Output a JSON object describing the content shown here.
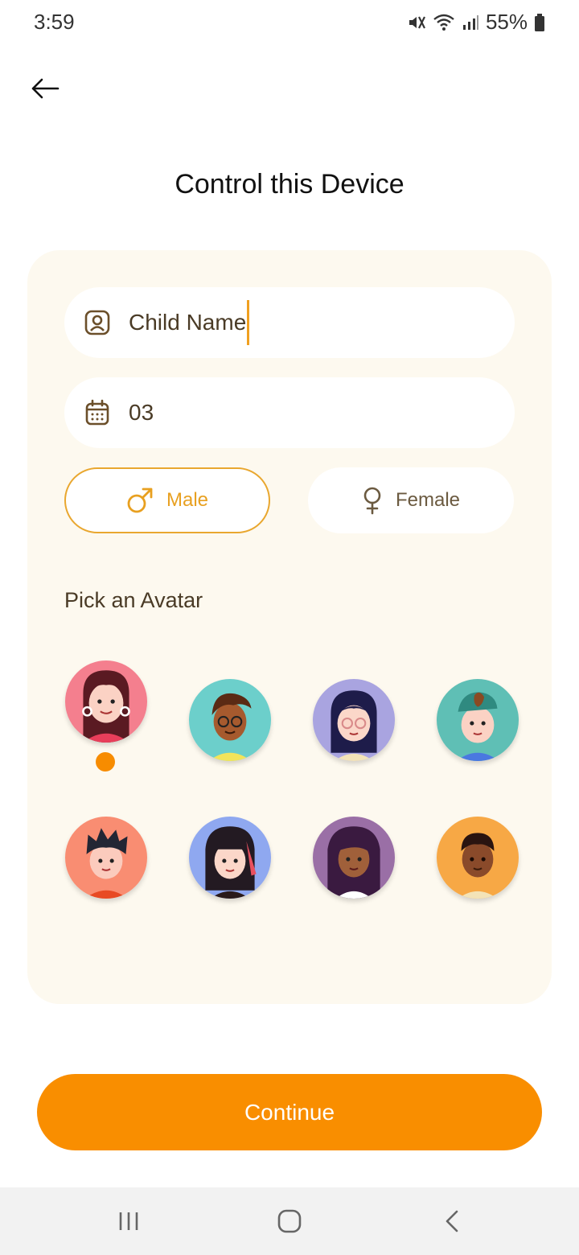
{
  "status_bar": {
    "time": "3:59",
    "battery": "55%"
  },
  "header": {
    "title": "Control this Device"
  },
  "form": {
    "name_value": "Child Name",
    "age_value": "03",
    "gender": {
      "male_label": "Male",
      "female_label": "Female",
      "selected": "male"
    },
    "avatar_heading": "Pick an Avatar",
    "selected_avatar_index": 0
  },
  "avatars": [
    {
      "bg": "#f47f8e",
      "name": "girl-earrings"
    },
    {
      "bg": "#6ccfcb",
      "name": "boy-glasses"
    },
    {
      "bg": "#a9a4e0",
      "name": "girl-glasses"
    },
    {
      "bg": "#5fbfb5",
      "name": "boy-cap"
    },
    {
      "bg": "#f98d72",
      "name": "boy-spiky"
    },
    {
      "bg": "#8fa8f0",
      "name": "girl-bangs"
    },
    {
      "bg": "#9a6fa6",
      "name": "girl-long-hair"
    },
    {
      "bg": "#f7a845",
      "name": "boy-tank"
    }
  ],
  "actions": {
    "continue_label": "Continue"
  },
  "colors": {
    "accent": "#f98e00",
    "card_bg": "#fdf9ef",
    "brown": "#6b4f2a"
  }
}
